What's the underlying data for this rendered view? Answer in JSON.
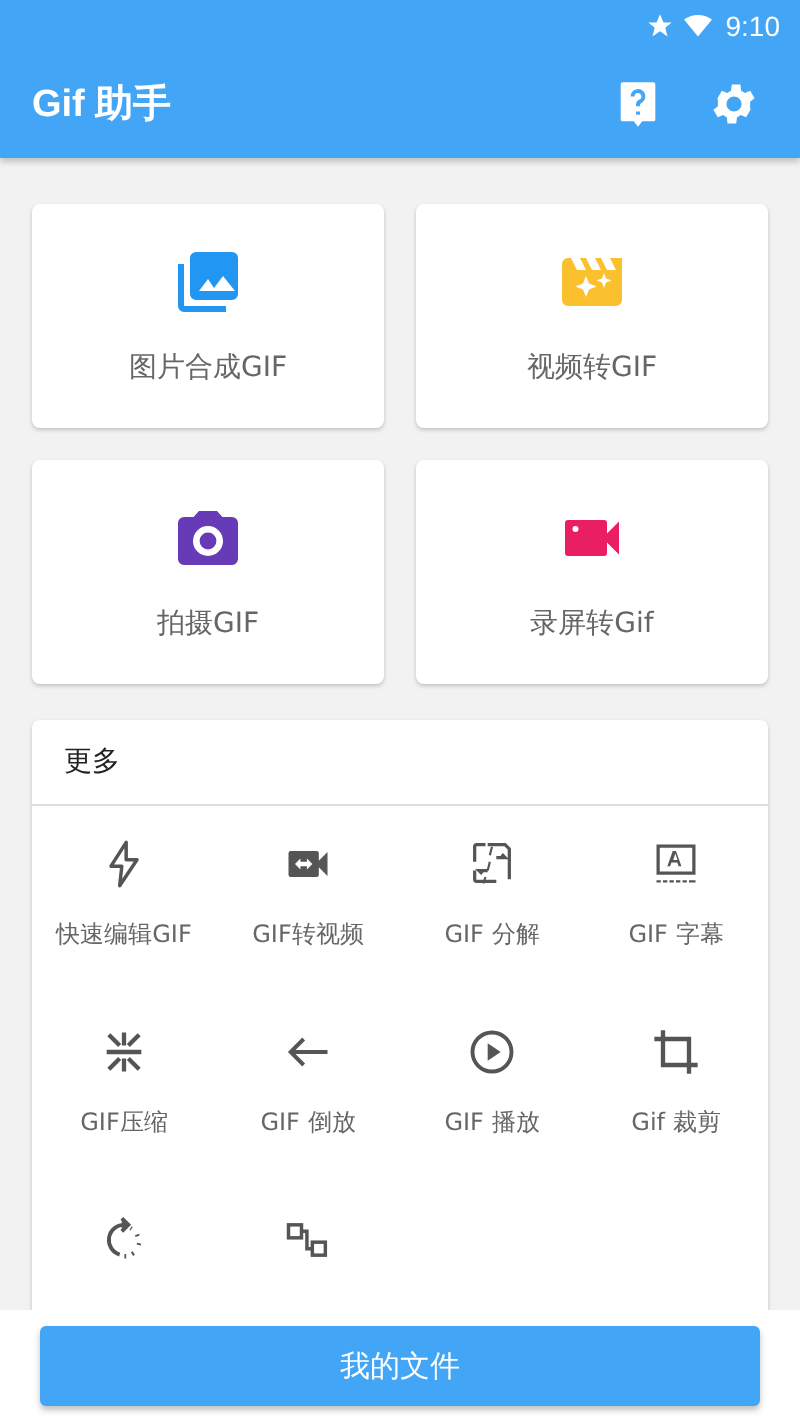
{
  "status_bar": {
    "time": "9:10"
  },
  "app_bar": {
    "title": "Gif 助手"
  },
  "main_cards": [
    {
      "label": "图片合成GIF"
    },
    {
      "label": "视频转GIF"
    },
    {
      "label": "拍摄GIF"
    },
    {
      "label": "录屏转Gif"
    }
  ],
  "more": {
    "title": "更多",
    "items": [
      {
        "label": "快速编辑GIF"
      },
      {
        "label": "GIF转视频"
      },
      {
        "label": "GIF 分解"
      },
      {
        "label": "GIF 字幕"
      },
      {
        "label": "GIF压缩"
      },
      {
        "label": "GIF 倒放"
      },
      {
        "label": "GIF 播放"
      },
      {
        "label": "Gif 裁剪"
      }
    ]
  },
  "bottom_button": {
    "label": "我的文件"
  }
}
